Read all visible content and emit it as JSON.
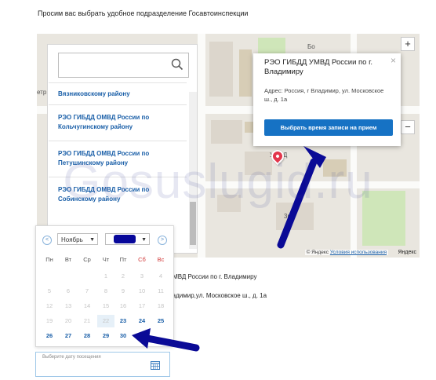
{
  "page": {
    "heading": "Просим вас выбрать удобное подразделение Госавтоинспекции",
    "watermark": "Gosuslugid.ru"
  },
  "map": {
    "labels": [
      "етр",
      "УМВД",
      "3м",
      "Бо"
    ],
    "zoom_in": "+",
    "zoom_out": "−",
    "copyright_prefix": "© Яндекс",
    "copyright_link": "Условия использования",
    "logo_text": "Яндекс",
    "popup": {
      "title": "РЭО ГИБДД УМВД России по г. Владимиру",
      "address": "Адрес: Россия, г Владимир, ул. Московское ш., д. 1а",
      "button_label": "Выбрать время записи на прием",
      "close": "×"
    }
  },
  "list": {
    "search_placeholder": "",
    "items": [
      {
        "label": "Вязниковскому району"
      },
      {
        "label": "РЭО ГИБДД ОМВД России по Кольчугинскому району"
      },
      {
        "label": "РЭО ГИБДД ОМВД России по Петушинскому району"
      },
      {
        "label": "РЭО ГИБДД ОМВД России по Собинскому району"
      }
    ]
  },
  "selected_info": {
    "name_partial": "УМВД России по г. Владимиру",
    "address_partial": "ладимир,ул. Московское ш., д. 1а"
  },
  "calendar": {
    "prev": "<",
    "next": ">",
    "month": "Ноябрь",
    "month_arrow": "▼",
    "year_arrow": "▼",
    "weekdays": [
      "Пн",
      "Вт",
      "Ср",
      "Чт",
      "Пт",
      "Сб",
      "Вс"
    ],
    "weeks": [
      [
        null,
        null,
        null,
        "1",
        "2",
        "3",
        "4"
      ],
      [
        "5",
        "6",
        "7",
        "8",
        "9",
        "10",
        "11"
      ],
      [
        "12",
        "13",
        "14",
        "15",
        "16",
        "17",
        "18"
      ],
      [
        "19",
        "20",
        "21",
        "22",
        "23",
        "24",
        "25"
      ],
      [
        "26",
        "27",
        "28",
        "29",
        "30",
        null,
        null
      ]
    ],
    "active_days": [
      "23",
      "24",
      "25",
      "26",
      "27",
      "28",
      "29",
      "30"
    ],
    "today": "22"
  },
  "date_field": {
    "label": "Выберите дату посещения"
  },
  "colors": {
    "accent": "#1672c4",
    "link": "#1a5fa8",
    "annotation_arrow": "#0a0a96",
    "marker": "#e3364b"
  }
}
